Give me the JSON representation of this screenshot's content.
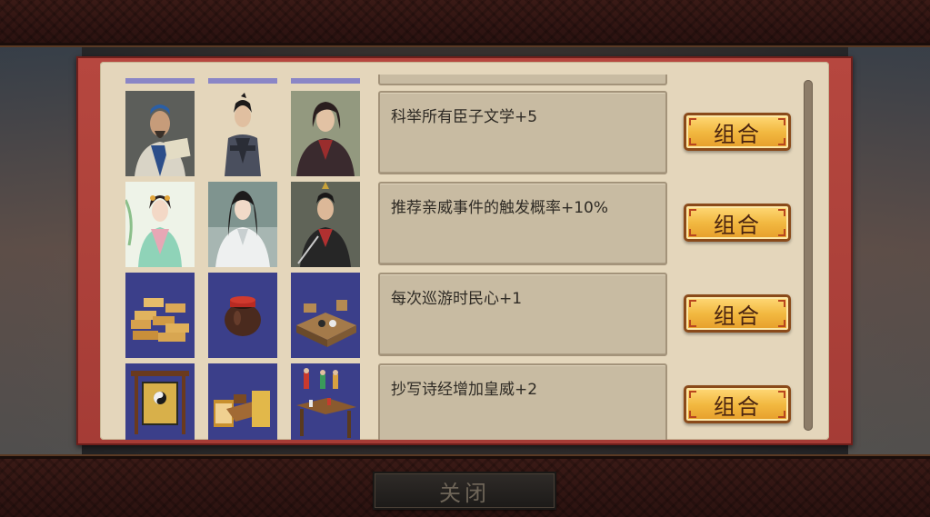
{
  "dialog": {
    "rows": [
      {
        "effect": "科举所有臣子文学+5",
        "button_label": "组合",
        "items": [
          "mentor-portrait",
          "scholar-portrait",
          "swordsman-portrait"
        ]
      },
      {
        "effect": "推荐亲威事件的触发概率+10%",
        "button_label": "组合",
        "items": [
          "court-lady-portrait",
          "white-robed-noble-portrait",
          "warrior-portrait"
        ]
      },
      {
        "effect": "每次巡游时民心+1",
        "button_label": "组合",
        "items": [
          "bamboo-scrolls-item",
          "wine-jar-item",
          "chess-table-item"
        ]
      },
      {
        "effect": "抄写诗经增加皇威+2",
        "button_label": "组合",
        "items": [
          "bagua-sign-item",
          "calligraphy-desk-item",
          "figurine-table-item"
        ]
      }
    ]
  },
  "footer": {
    "close_label": "关闭"
  },
  "colors": {
    "panel_border": "#a53c36",
    "panel_background": "#e4d6bb",
    "effect_box": "#c8bba2",
    "button_gold": "#f2b941",
    "item_background": "#3b3f8a"
  }
}
